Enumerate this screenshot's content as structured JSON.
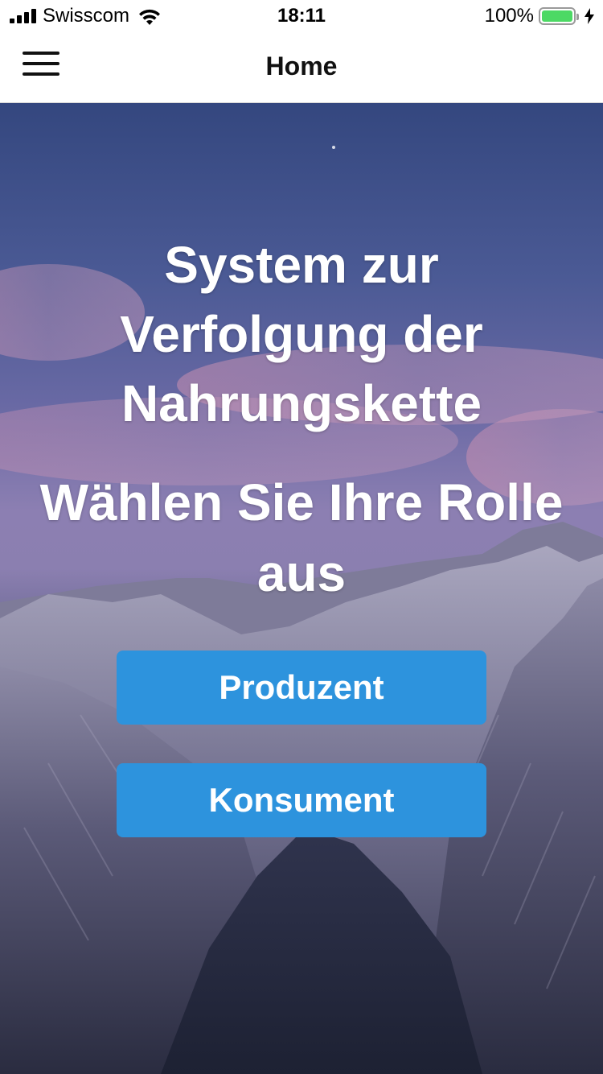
{
  "status_bar": {
    "carrier": "Swisscom",
    "time": "18:11",
    "battery_percent": "100%",
    "battery_color": "#4cd964",
    "icons": [
      "signal-icon",
      "wifi-icon",
      "battery-icon",
      "charging-bolt-icon"
    ]
  },
  "nav": {
    "title": "Home",
    "menu_icon": "hamburger-menu-icon"
  },
  "hero": {
    "headline": "System zur Verfolgung der Nahrungskette",
    "prompt": "Wählen Sie Ihre Rolle aus",
    "background": "mountain-landscape-image"
  },
  "roles": {
    "producer_label": "Produzent",
    "consumer_label": "Konsument",
    "button_color": "#2d93dd"
  }
}
